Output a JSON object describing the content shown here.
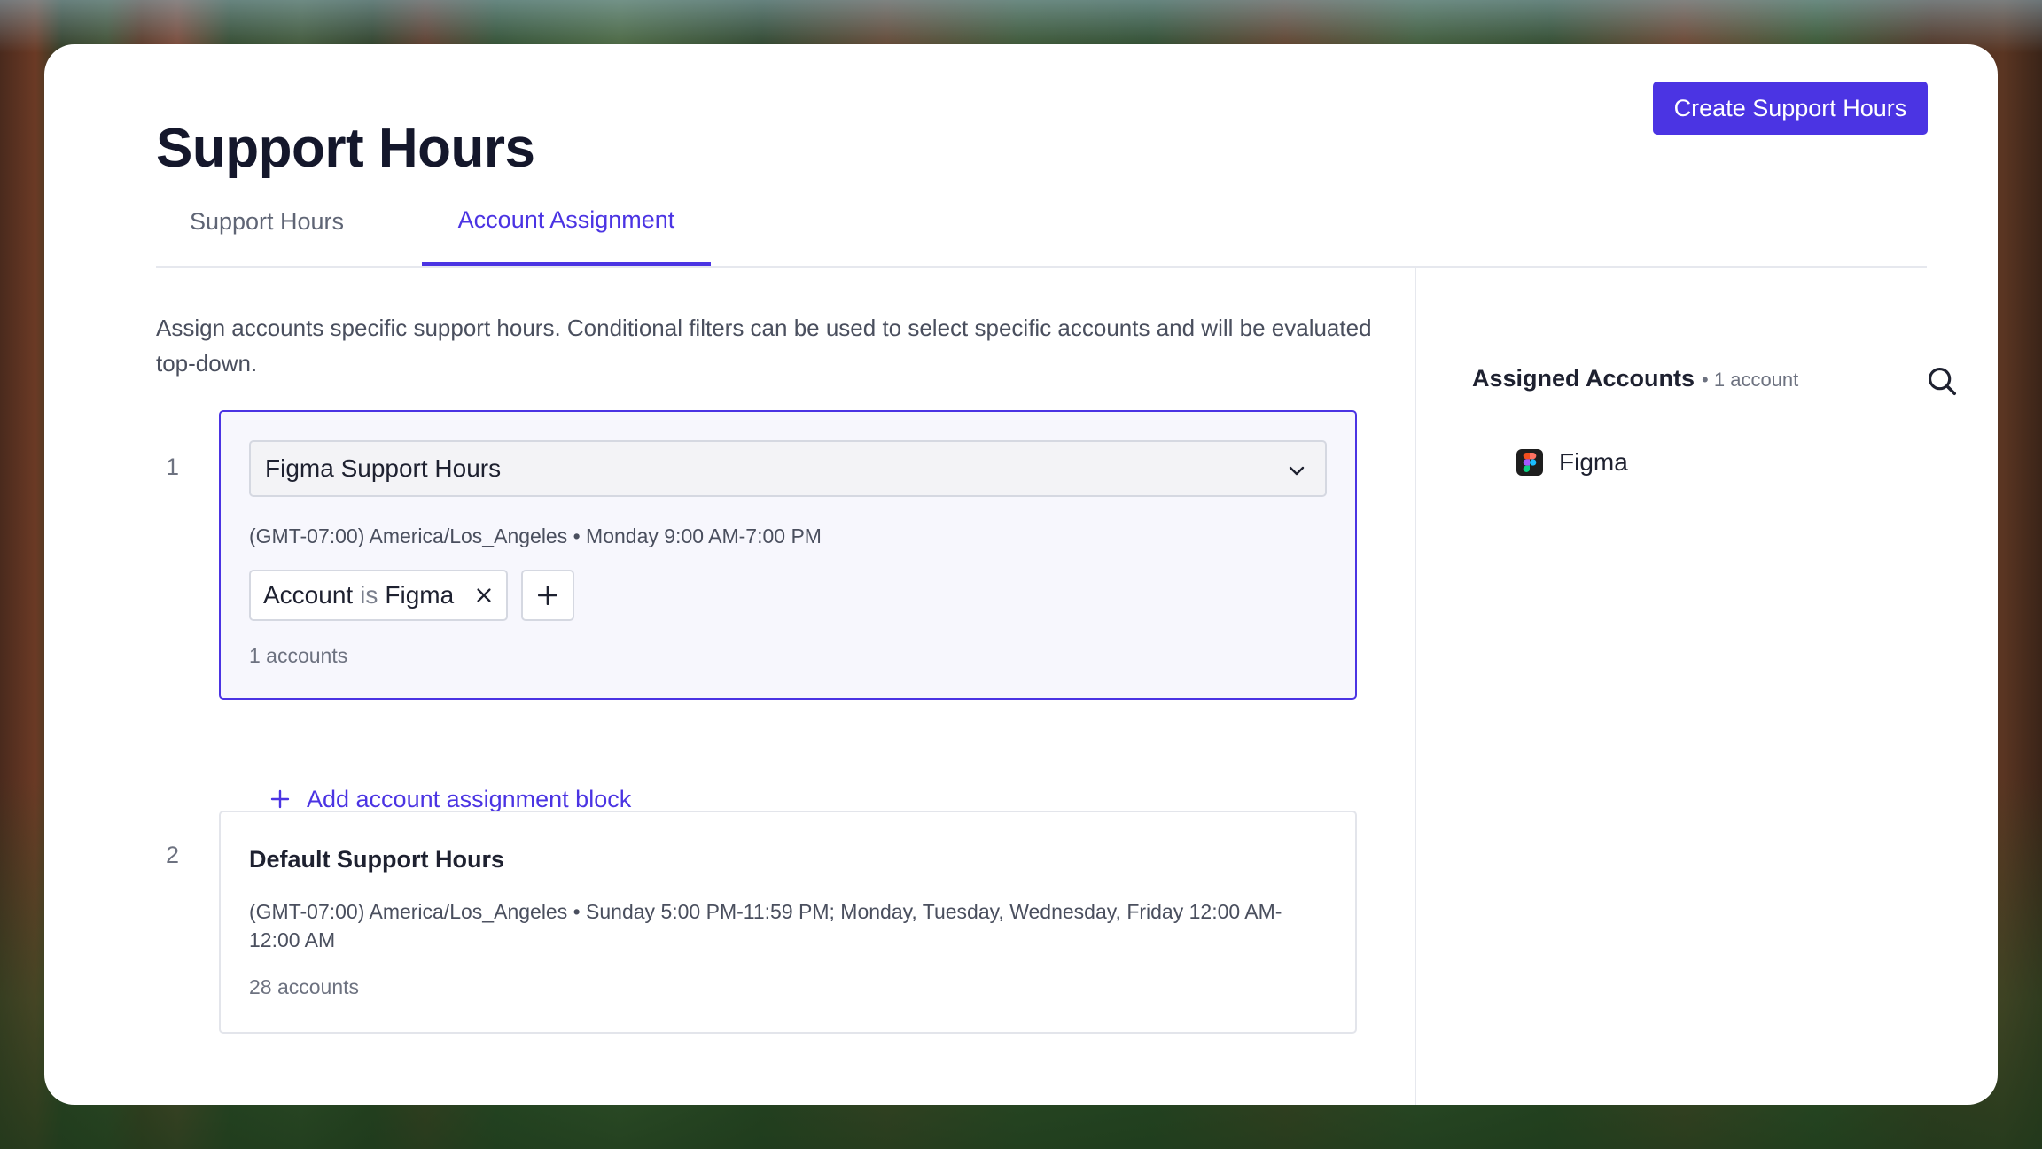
{
  "page": {
    "title": "Support Hours",
    "create_button": "Create Support Hours"
  },
  "tabs": [
    {
      "label": "Support Hours",
      "active": false
    },
    {
      "label": "Account Assignment",
      "active": true
    }
  ],
  "description": "Assign accounts specific support hours. Conditional filters can be used to select specific accounts and will be evaluated top-down.",
  "blocks": [
    {
      "index": "1",
      "selected_hours": "Figma Support Hours",
      "schedule": "(GMT-07:00) America/Los_Angeles • Monday 9:00 AM-7:00 PM",
      "filter": {
        "field": "Account",
        "operator": "is",
        "value": "Figma"
      },
      "accounts": "1 accounts"
    },
    {
      "index": "2",
      "title": "Default Support Hours",
      "schedule": "(GMT-07:00) America/Los_Angeles • Sunday 5:00 PM-11:59 PM; Monday, Tuesday, Wednesday, Friday 12:00 AM-12:00 AM",
      "accounts": "28 accounts"
    }
  ],
  "add_block_label": "Add account assignment block",
  "sidebar": {
    "title": "Assigned Accounts",
    "count": "• 1 account",
    "accounts": [
      {
        "name": "Figma",
        "icon": "figma-logo-icon"
      }
    ]
  },
  "colors": {
    "accent": "#4b34e3",
    "text": "#1e2130",
    "muted": "#6d7280",
    "border": "#d5d8e1"
  }
}
